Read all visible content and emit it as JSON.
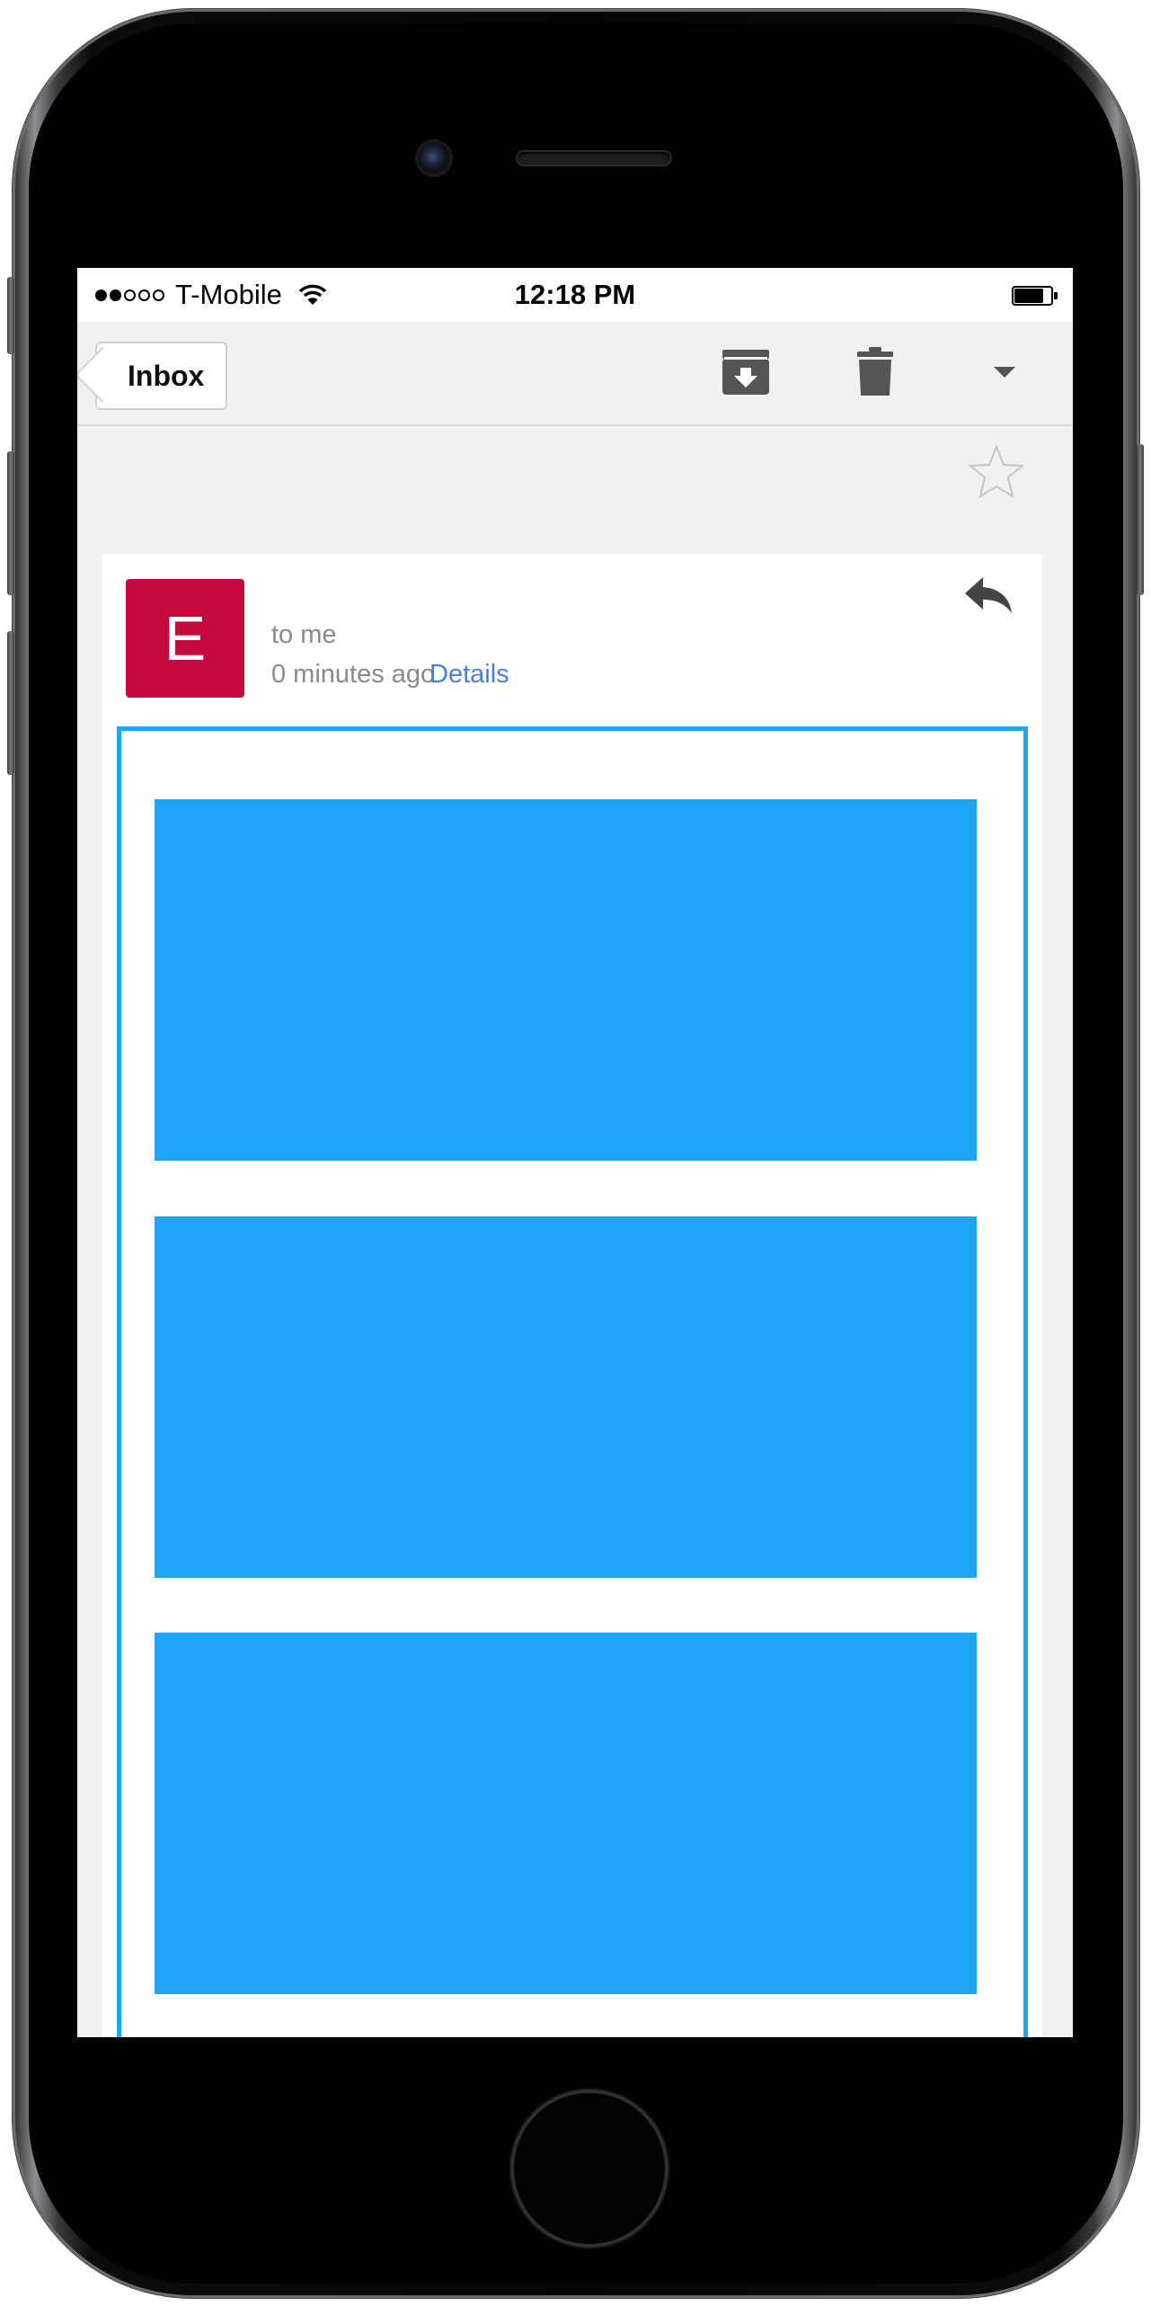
{
  "status_bar": {
    "carrier": "T-Mobile",
    "time": "12:18 PM",
    "signal_dots": [
      true,
      true,
      false,
      false,
      false
    ]
  },
  "toolbar": {
    "back_label": "Inbox",
    "icons": [
      "archive-icon",
      "trash-icon",
      "chevron-down-icon"
    ]
  },
  "message": {
    "avatar_letter": "E",
    "avatar_color": "#c5083d",
    "recipient": "to me",
    "time": "0 minutes ago",
    "details_link": "Details",
    "link_color": "#4a7fd6"
  },
  "email_body": {
    "accent_color": "#1ea5f5",
    "placeholder_blocks": 3
  }
}
